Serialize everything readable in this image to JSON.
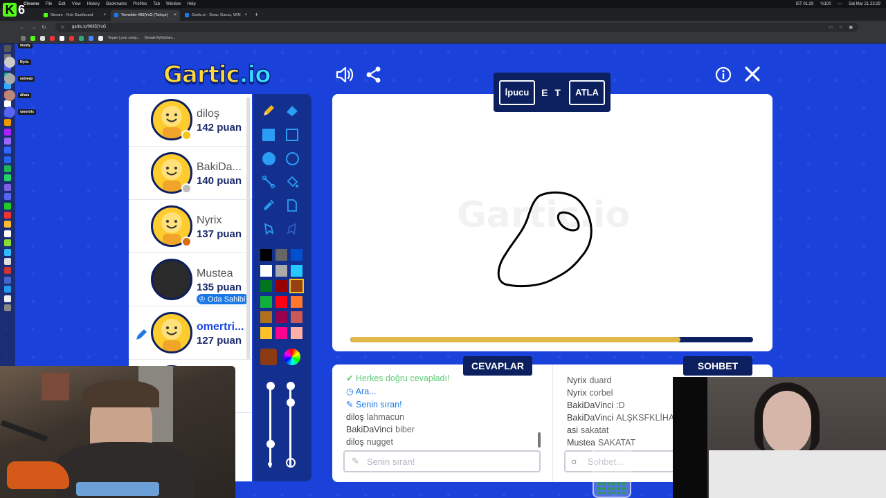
{
  "menubar": {
    "items": [
      "File",
      "Edit",
      "View",
      "History",
      "Bookmarks",
      "Profiles",
      "Tab",
      "Window",
      "Help"
    ],
    "app": "Chrome",
    "status_time": "IST 01:29",
    "battery": "%100",
    "datetime": "Sat Mar 21 23:29"
  },
  "kick": {
    "logo_letter": "K",
    "viewer_count": "6"
  },
  "browser": {
    "tabs": [
      {
        "label": "Stream - Kick Dashboard",
        "color": "#53fc18"
      },
      {
        "label": "Yemekler #65|YcG (Türkçe)",
        "color": "#1b78e6"
      },
      {
        "label": "Gartic.io - Draw, Guess, WIN",
        "color": "#1b78e6"
      }
    ],
    "url": "gartic.io/0665|YcG",
    "bookmarks": [
      "Vegan | your comp...",
      "Donate ByNoGam..."
    ]
  },
  "discord": {
    "users": [
      "musty",
      "Nyrix",
      "asiyeap",
      "dilara",
      "omertrix"
    ]
  },
  "game": {
    "logo": "Gartic",
    "logo_suffix": ".io",
    "watermark": "Gartic.io",
    "hint_button": "İpucu",
    "hint_word": "E T",
    "skip_button": "ATLA",
    "timer_fraction": 0.82,
    "answers_title": "CEVAPLAR",
    "chat_title": "SOHBET",
    "answer_placeholder": "Senin sıran!",
    "chat_placeholder": "Sohbet...",
    "owner_badge": "Oda Sahibi"
  },
  "players": [
    {
      "name": "diloş",
      "score": "142 puan",
      "dot": "#f5c518"
    },
    {
      "name": "BakiDa...",
      "score": "140 puan",
      "dot": "#bdbdbd"
    },
    {
      "name": "Nyrix",
      "score": "137 puan",
      "dot": "#d86a14"
    },
    {
      "name": "Mustea",
      "score": "135 puan",
      "dot": ""
    },
    {
      "name": "omertri...",
      "score": "127 puan",
      "dot": ""
    },
    {
      "name": "",
      "score": "an",
      "dot": ""
    }
  ],
  "answers": [
    {
      "type": "ok",
      "text": "Herkes doğru cevapladı!"
    },
    {
      "type": "sys",
      "text": "Ara..."
    },
    {
      "type": "sys",
      "text": "Senin sıran!"
    },
    {
      "type": "msg",
      "user": "diloş",
      "text": "lahmacun"
    },
    {
      "type": "msg",
      "user": "BakiDaVinci",
      "text": "biber"
    },
    {
      "type": "msg",
      "user": "diloş",
      "text": "nugget"
    }
  ],
  "chat": [
    {
      "user": "Nyrix",
      "text": "duard"
    },
    {
      "user": "Nyrix",
      "text": "corbel"
    },
    {
      "user": "BakiDaVinci",
      "text": ":D"
    },
    {
      "user": "BakiDaVinci",
      "text": "ALŞKSFKLİHA"
    },
    {
      "user": "asi",
      "text": "sakatat"
    },
    {
      "user": "Mustea",
      "text": "SAKATAT"
    }
  ],
  "palette": {
    "colors": [
      "#000000",
      "#666666",
      "#0050cd",
      "#ffffff",
      "#aaaaaa",
      "#26c9ff",
      "#017420",
      "#990000",
      "#964112",
      "#11b03c",
      "#ff0013",
      "#ff7829",
      "#b0701c",
      "#99004e",
      "#cb5a57",
      "#ffc126",
      "#ff008f",
      "#feafa8"
    ],
    "selected": "#964112",
    "accent": "#1a42da"
  }
}
